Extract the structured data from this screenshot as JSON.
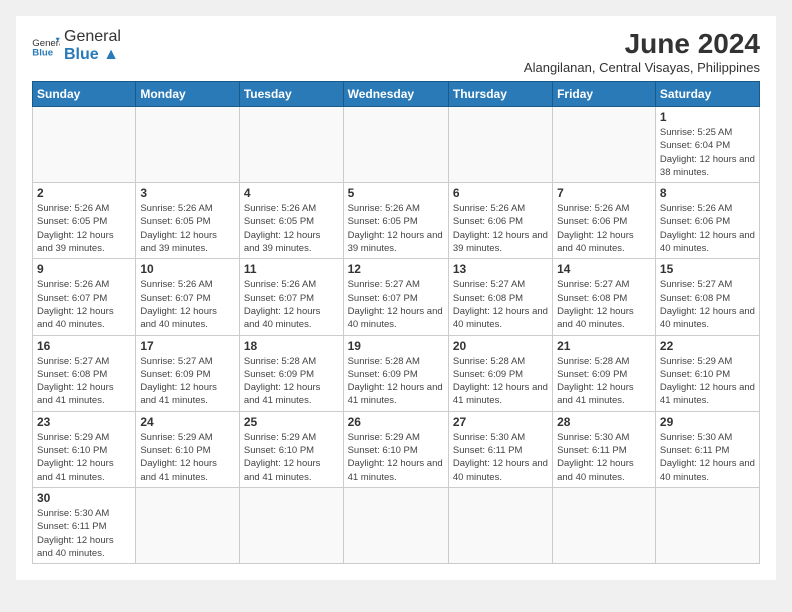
{
  "header": {
    "logo_general": "General",
    "logo_blue": "Blue",
    "month_year": "June 2024",
    "location": "Alangilanan, Central Visayas, Philippines"
  },
  "days_of_week": [
    "Sunday",
    "Monday",
    "Tuesday",
    "Wednesday",
    "Thursday",
    "Friday",
    "Saturday"
  ],
  "weeks": [
    {
      "days": [
        {
          "num": "",
          "info": ""
        },
        {
          "num": "",
          "info": ""
        },
        {
          "num": "",
          "info": ""
        },
        {
          "num": "",
          "info": ""
        },
        {
          "num": "",
          "info": ""
        },
        {
          "num": "",
          "info": ""
        },
        {
          "num": "1",
          "info": "Sunrise: 5:25 AM\nSunset: 6:04 PM\nDaylight: 12 hours and 38 minutes."
        }
      ]
    },
    {
      "days": [
        {
          "num": "2",
          "info": "Sunrise: 5:26 AM\nSunset: 6:05 PM\nDaylight: 12 hours and 39 minutes."
        },
        {
          "num": "3",
          "info": "Sunrise: 5:26 AM\nSunset: 6:05 PM\nDaylight: 12 hours and 39 minutes."
        },
        {
          "num": "4",
          "info": "Sunrise: 5:26 AM\nSunset: 6:05 PM\nDaylight: 12 hours and 39 minutes."
        },
        {
          "num": "5",
          "info": "Sunrise: 5:26 AM\nSunset: 6:05 PM\nDaylight: 12 hours and 39 minutes."
        },
        {
          "num": "6",
          "info": "Sunrise: 5:26 AM\nSunset: 6:06 PM\nDaylight: 12 hours and 39 minutes."
        },
        {
          "num": "7",
          "info": "Sunrise: 5:26 AM\nSunset: 6:06 PM\nDaylight: 12 hours and 40 minutes."
        },
        {
          "num": "8",
          "info": "Sunrise: 5:26 AM\nSunset: 6:06 PM\nDaylight: 12 hours and 40 minutes."
        }
      ]
    },
    {
      "days": [
        {
          "num": "9",
          "info": "Sunrise: 5:26 AM\nSunset: 6:07 PM\nDaylight: 12 hours and 40 minutes."
        },
        {
          "num": "10",
          "info": "Sunrise: 5:26 AM\nSunset: 6:07 PM\nDaylight: 12 hours and 40 minutes."
        },
        {
          "num": "11",
          "info": "Sunrise: 5:26 AM\nSunset: 6:07 PM\nDaylight: 12 hours and 40 minutes."
        },
        {
          "num": "12",
          "info": "Sunrise: 5:27 AM\nSunset: 6:07 PM\nDaylight: 12 hours and 40 minutes."
        },
        {
          "num": "13",
          "info": "Sunrise: 5:27 AM\nSunset: 6:08 PM\nDaylight: 12 hours and 40 minutes."
        },
        {
          "num": "14",
          "info": "Sunrise: 5:27 AM\nSunset: 6:08 PM\nDaylight: 12 hours and 40 minutes."
        },
        {
          "num": "15",
          "info": "Sunrise: 5:27 AM\nSunset: 6:08 PM\nDaylight: 12 hours and 40 minutes."
        }
      ]
    },
    {
      "days": [
        {
          "num": "16",
          "info": "Sunrise: 5:27 AM\nSunset: 6:08 PM\nDaylight: 12 hours and 41 minutes."
        },
        {
          "num": "17",
          "info": "Sunrise: 5:27 AM\nSunset: 6:09 PM\nDaylight: 12 hours and 41 minutes."
        },
        {
          "num": "18",
          "info": "Sunrise: 5:28 AM\nSunset: 6:09 PM\nDaylight: 12 hours and 41 minutes."
        },
        {
          "num": "19",
          "info": "Sunrise: 5:28 AM\nSunset: 6:09 PM\nDaylight: 12 hours and 41 minutes."
        },
        {
          "num": "20",
          "info": "Sunrise: 5:28 AM\nSunset: 6:09 PM\nDaylight: 12 hours and 41 minutes."
        },
        {
          "num": "21",
          "info": "Sunrise: 5:28 AM\nSunset: 6:09 PM\nDaylight: 12 hours and 41 minutes."
        },
        {
          "num": "22",
          "info": "Sunrise: 5:29 AM\nSunset: 6:10 PM\nDaylight: 12 hours and 41 minutes."
        }
      ]
    },
    {
      "days": [
        {
          "num": "23",
          "info": "Sunrise: 5:29 AM\nSunset: 6:10 PM\nDaylight: 12 hours and 41 minutes."
        },
        {
          "num": "24",
          "info": "Sunrise: 5:29 AM\nSunset: 6:10 PM\nDaylight: 12 hours and 41 minutes."
        },
        {
          "num": "25",
          "info": "Sunrise: 5:29 AM\nSunset: 6:10 PM\nDaylight: 12 hours and 41 minutes."
        },
        {
          "num": "26",
          "info": "Sunrise: 5:29 AM\nSunset: 6:10 PM\nDaylight: 12 hours and 41 minutes."
        },
        {
          "num": "27",
          "info": "Sunrise: 5:30 AM\nSunset: 6:11 PM\nDaylight: 12 hours and 40 minutes."
        },
        {
          "num": "28",
          "info": "Sunrise: 5:30 AM\nSunset: 6:11 PM\nDaylight: 12 hours and 40 minutes."
        },
        {
          "num": "29",
          "info": "Sunrise: 5:30 AM\nSunset: 6:11 PM\nDaylight: 12 hours and 40 minutes."
        }
      ]
    },
    {
      "days": [
        {
          "num": "30",
          "info": "Sunrise: 5:30 AM\nSunset: 6:11 PM\nDaylight: 12 hours and 40 minutes."
        },
        {
          "num": "",
          "info": ""
        },
        {
          "num": "",
          "info": ""
        },
        {
          "num": "",
          "info": ""
        },
        {
          "num": "",
          "info": ""
        },
        {
          "num": "",
          "info": ""
        },
        {
          "num": "",
          "info": ""
        }
      ]
    }
  ]
}
